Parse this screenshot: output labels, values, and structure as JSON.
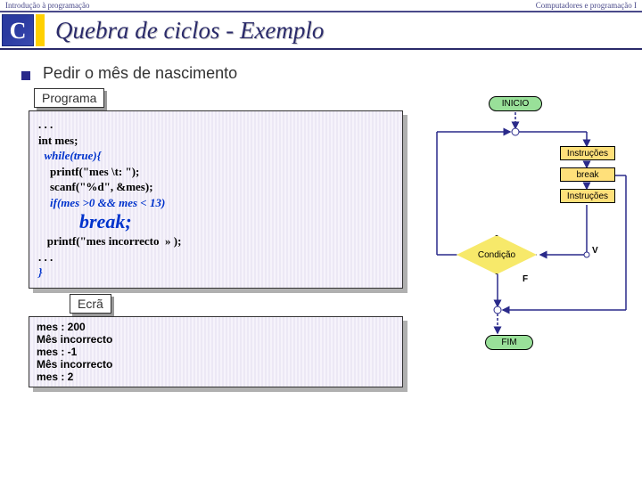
{
  "header": {
    "left": "Introdução à programação",
    "right": "Computadores e programação I"
  },
  "title": "Quebra de ciclos - Exemplo",
  "bullet": "Pedir o mês de nascimento",
  "labels": {
    "program": "Programa",
    "screen": "Ecrã"
  },
  "code": {
    "l0": ". . .",
    "l1": "int mes;",
    "l2": "  while(true){",
    "l3": "    printf(\"mes \\t: \");",
    "l4": "    scanf(\"%d\", &mes);",
    "l5": "    if(mes >0 && mes < 13)",
    "l6": "break;",
    "l7": "   printf(\"mes incorrecto  » );",
    "l8": ". . .",
    "l9": "}"
  },
  "screen": {
    "l1": "mes : 200",
    "l2": "Mês incorrecto",
    "l3": "mes : -1",
    "l4": "Mês incorrecto",
    "l5": "mes : 2"
  },
  "flow": {
    "start": "INICIO",
    "instr": "Instruções",
    "brk": "break",
    "cond": "Condição",
    "end": "FIM",
    "true": "V",
    "false": "F"
  }
}
